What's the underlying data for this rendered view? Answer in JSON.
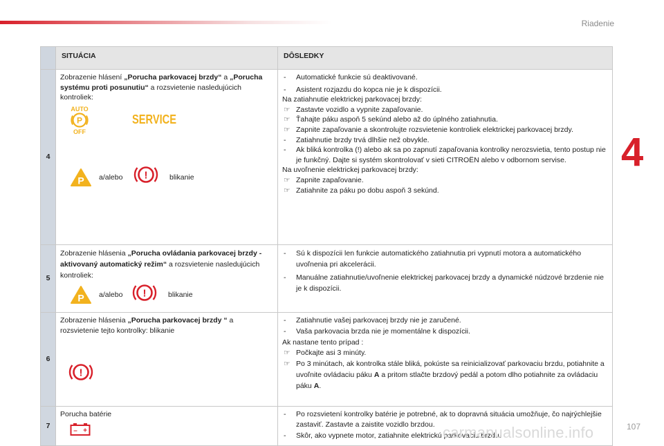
{
  "header": {
    "section": "Riadenie",
    "chapter": "4",
    "page": "107"
  },
  "watermark": "carmanualsonline.info",
  "table": {
    "col_situation": "SITUÁCIA",
    "col_consequences": "DÔSLEDKY",
    "rows": [
      {
        "num": "4",
        "sit_pre": "Zobrazenie hlásení ",
        "sit_b1": "„Porucha parkovacej brzdy“",
        "sit_mid": " a ",
        "sit_b2": "„Porucha systému proti posunutiu“",
        "sit_post": " a rozsvietenie nasledujúcich kontroliek:",
        "icon_auto_top": "AUTO",
        "icon_auto_bottom": "OFF",
        "icon_auto_letter": "P",
        "icon_service": "SERVICE",
        "icon_p": "P",
        "icon_excl": "!",
        "or_label": "a/alebo",
        "blink_label": "blikanie",
        "cons": [
          {
            "mk": "-",
            "text": "Automatické funkcie sú deaktivované."
          },
          {
            "mk": "-",
            "text": "Asistent rozjazdu do kopca nie je k dispozícii."
          },
          {
            "mk": "",
            "text": "Na zatiahnutie elektrickej parkovacej brzdy:"
          },
          {
            "mk": "☞",
            "text": "Zastavte vozidlo a vypnite zapaľovanie."
          },
          {
            "mk": "☞",
            "text": "Ťahajte páku aspoň 5 sekúnd alebo až do úplného zatiahnutia."
          },
          {
            "mk": "☞",
            "text": "Zapnite zapaľovanie a skontrolujte rozsvietenie kontroliek elektrickej parkovacej brzdy."
          },
          {
            "mk": "-",
            "text": "Zatiahnutie brzdy trvá dlhšie než obvykle."
          },
          {
            "mk": "-",
            "text": "Ak bliká kontrolka (!) alebo ak sa po zapnutí zapaľovania kontrolky nerozsvietia, tento postup nie je funkčný. Dajte si systém skontrolovať v sieti CITROËN alebo v odbornom servise."
          },
          {
            "mk": "",
            "text": "Na uvoľnenie elektrickej parkovacej brzdy:"
          },
          {
            "mk": "☞",
            "text": "Zapnite zapaľovanie."
          },
          {
            "mk": "☞",
            "text": "Zatiahnite za páku po dobu aspoň 3 sekúnd."
          }
        ]
      },
      {
        "num": "5",
        "sit_pre": "Zobrazenie hlásenia ",
        "sit_b1": "„Porucha ovládania parkovacej brzdy - aktivovaný automatický režim“",
        "sit_post": " a rozsvietenie nasledujúcich kontroliek:",
        "icon_p": "P",
        "icon_excl": "!",
        "or_label": "a/alebo",
        "blink_label": "blikanie",
        "cons": [
          {
            "mk": "-",
            "text": "Sú k dispozícii len funkcie automatického zatiahnutia pri vypnutí motora a automatického uvoľnenia pri akcelerácii."
          },
          {
            "mk": "-",
            "text": "Manuálne zatiahnutie/uvoľnenie elektrickej parkovacej brzdy a dynamické núdzové brzdenie nie je k dispozícii."
          }
        ]
      },
      {
        "num": "6",
        "sit_pre": "Zobrazenie hlásenia ",
        "sit_b1": "„Porucha parkovacej brzdy “",
        "sit_post": " a rozsvietenie tejto kontrolky: blikanie",
        "icon_excl": "!",
        "cons": [
          {
            "mk": "-",
            "text": "Zatiahnutie vašej parkovacej brzdy nie je zaručené."
          },
          {
            "mk": "-",
            "text": "Vaša parkovacia brzda nie je momentálne k dispozícii."
          },
          {
            "mk": "",
            "text": "Ak nastane tento prípad :"
          },
          {
            "mk": "☞",
            "text": "Počkajte asi 3 minúty."
          },
          {
            "mk": "☞",
            "text_pre": "Po 3 minútach, ak kontrolka stále bliká, pokúste sa reinicializovať parkovaciu brzdu, potiahnite a uvoľnite ovládaciu páku ",
            "text_b": "A",
            "text_mid": " a pritom stlačte brzdový pedál a potom dlho potiahnite za ovládaciu páku ",
            "text_b2": "A",
            "text_post": "."
          }
        ]
      },
      {
        "num": "7",
        "sit_text": "Porucha batérie",
        "icon_batt_minus": "–",
        "icon_batt_plus": "+",
        "cons": [
          {
            "mk": "-",
            "text": "Po rozsvietení kontrolky batérie je potrebné, ak to dopravná situácia umožňuje, čo najrýchlejšie zastaviť. Zastavte a zaistite vozidlo brzdou."
          },
          {
            "mk": "-",
            "text": "Skôr, ako vypnete motor, zatiahnite elektrickú parkovaciu brzdu."
          }
        ]
      }
    ]
  },
  "colors": {
    "accent_red": "#d8202a",
    "icon_amber": "#f2b21e",
    "icon_red": "#d8202a",
    "header_gray": "#e5e5e5",
    "num_blue": "#d0d7e0"
  }
}
